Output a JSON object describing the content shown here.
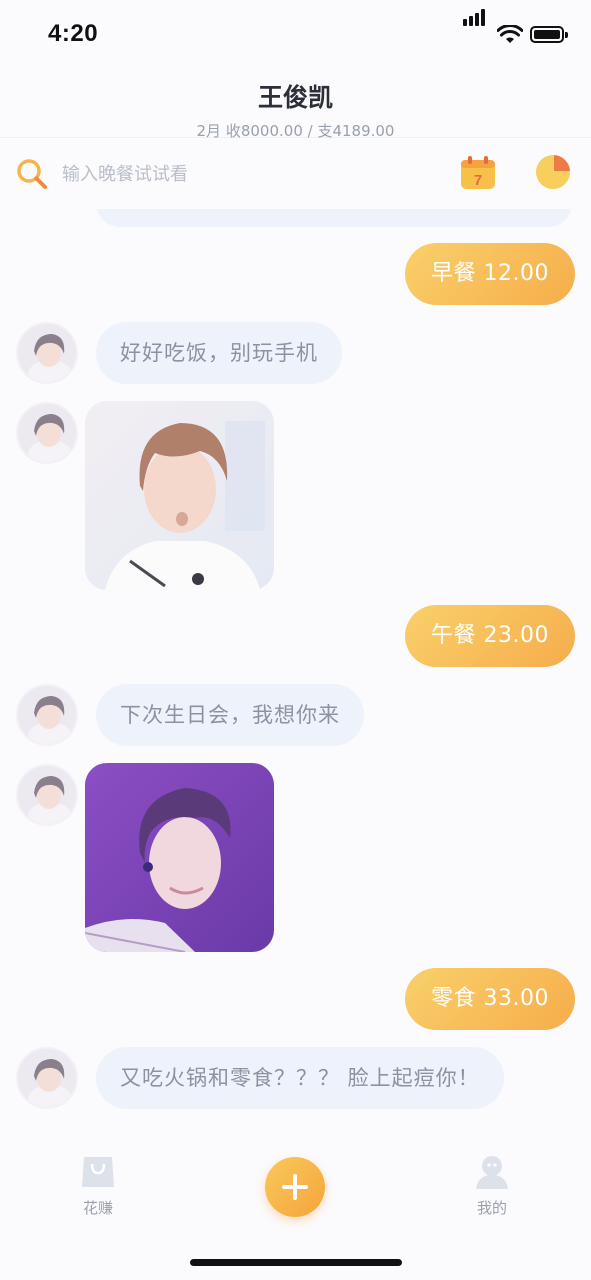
{
  "status_bar": {
    "time": "4:20"
  },
  "header": {
    "title": "王俊凯",
    "summary": "2月 收8000.00 / 支4189.00"
  },
  "search": {
    "placeholder": "输入晚餐试试看"
  },
  "icons": {
    "search": "search-icon",
    "calendar": "calendar-icon",
    "calendar_day": "7",
    "chart": "pie-chart-icon",
    "add": "plus-icon",
    "spend_tab": "shopping-bag-icon",
    "profile_tab": "person-icon"
  },
  "colors": {
    "accent": "#f6b44f",
    "bubble_gray": "#eef2fa",
    "text_gray": "#8b93a3"
  },
  "messages": [
    {
      "side": "right",
      "type": "expense",
      "text": "早餐 12.00"
    },
    {
      "side": "left",
      "type": "text",
      "text": "好好吃饭，别玩手机"
    },
    {
      "side": "left",
      "type": "image"
    },
    {
      "side": "right",
      "type": "expense",
      "text": "午餐 23.00"
    },
    {
      "side": "left",
      "type": "text",
      "text": "下次生日会，我想你来"
    },
    {
      "side": "left",
      "type": "image"
    },
    {
      "side": "right",
      "type": "expense",
      "text": "零食 33.00"
    },
    {
      "side": "left",
      "type": "text",
      "text": "又吃火锅和零食？？？ 脸上起痘你！"
    }
  ],
  "tab_bar": {
    "tabs": [
      {
        "label": "花赚"
      },
      {
        "label": "我的"
      }
    ]
  }
}
